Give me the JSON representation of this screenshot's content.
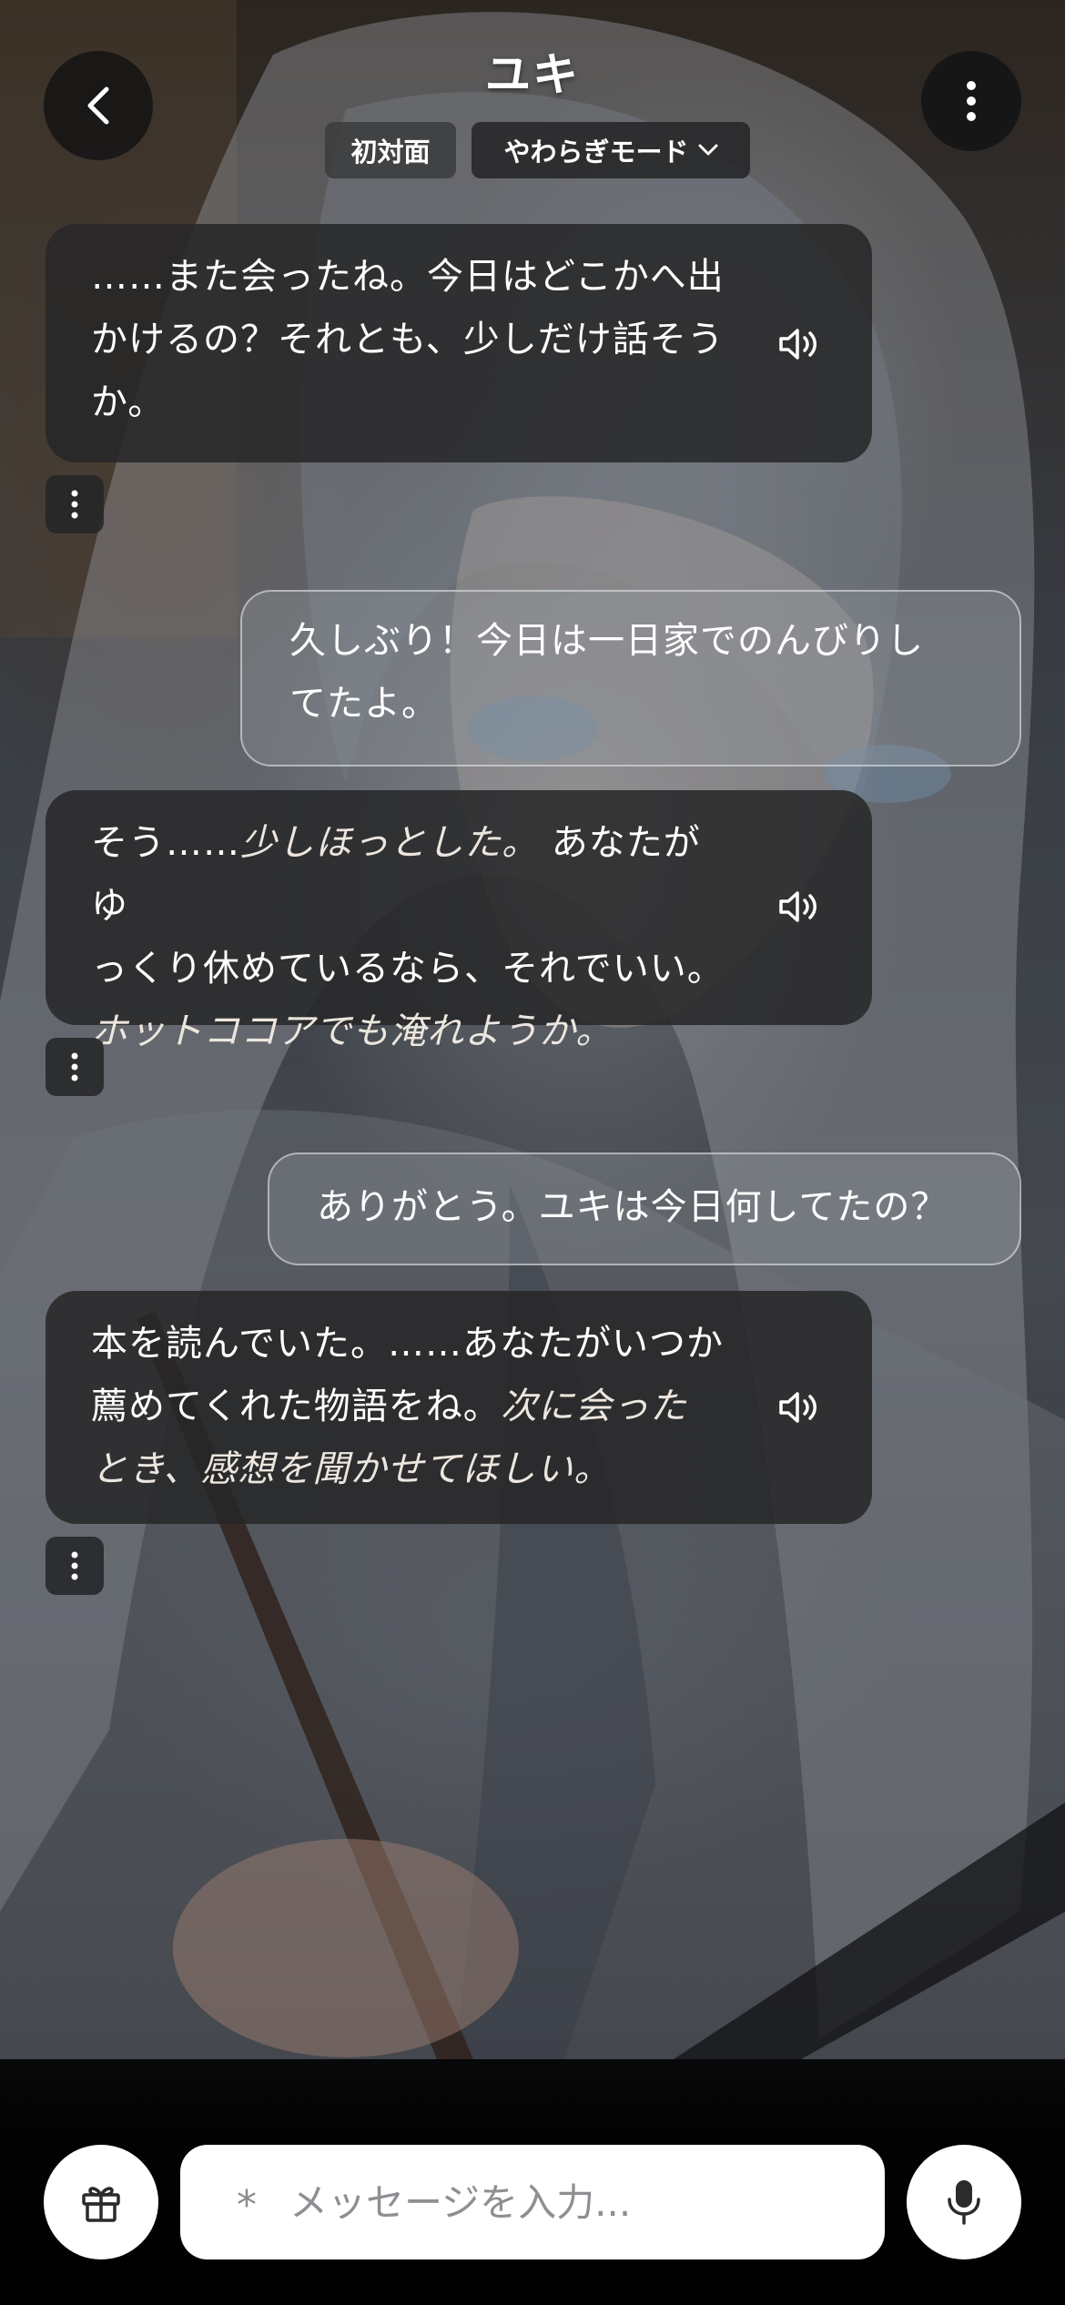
{
  "header": {
    "back_icon": "chevron-left-icon",
    "title": "ユキ",
    "status_badge": "初対面",
    "mode_label": "やわらぎモード",
    "more_icon": "more-vertical-icon"
  },
  "messages": [
    {
      "role": "ai",
      "lines": [
        "……また会ったね。今日はどこかへ出",
        "かけるの？それとも、少しだけ話そう",
        "か。"
      ]
    },
    {
      "role": "user",
      "lines": [
        "久しぶり！今日は一日家でのんびりし",
        "てたよ。"
      ]
    },
    {
      "role": "ai",
      "line1_plain": "そう……",
      "line1_italic": "少しほっとした。",
      "line1_rest": " あなたがゆ",
      "line2": "っくり休めているなら、それでいい。",
      "line3_italic": "ホットココアでも淹れようか。"
    },
    {
      "role": "user",
      "lines": [
        "ありがとう。ユキは今日何してたの？"
      ]
    },
    {
      "role": "ai",
      "line1": "本を読んでいた。……あなたがいつか",
      "line2_plain": "薦めてくれた物語をね。",
      "line2_italic": "次に会った",
      "line3_italic": "とき、感想を聞かせてほしい。"
    }
  ],
  "input": {
    "gift_icon": "gift-icon",
    "asterisk": "*",
    "placeholder": "メッセージを入力...",
    "mic_icon": "microphone-icon"
  }
}
